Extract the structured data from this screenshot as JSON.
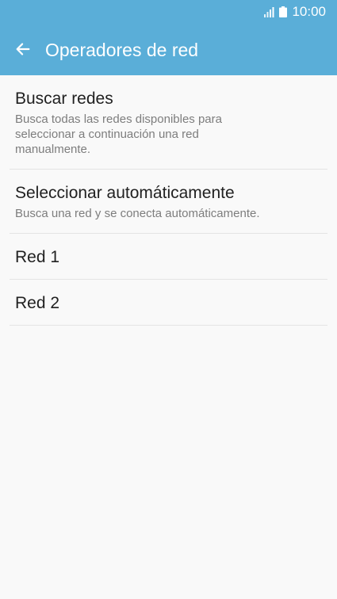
{
  "status_bar": {
    "time": "10:00",
    "icons": [
      "signal-icon",
      "battery-icon"
    ]
  },
  "app_bar": {
    "title": "Operadores de red",
    "back_icon": "arrow-left-icon"
  },
  "list": {
    "items": [
      {
        "title": "Buscar redes",
        "summary": "Busca todas las redes disponibles para seleccionar a continuación una red manualmente."
      },
      {
        "title": "Seleccionar automáticamente",
        "summary": "Busca una red y se conecta automáticamente."
      },
      {
        "title": "Red 1"
      },
      {
        "title": "Red 2"
      }
    ]
  },
  "colors": {
    "header": "#5aaed8",
    "background": "#f9f9f9",
    "title_text": "#212121",
    "summary_text": "#7d7d7d",
    "divider": "#e4e4e4"
  }
}
